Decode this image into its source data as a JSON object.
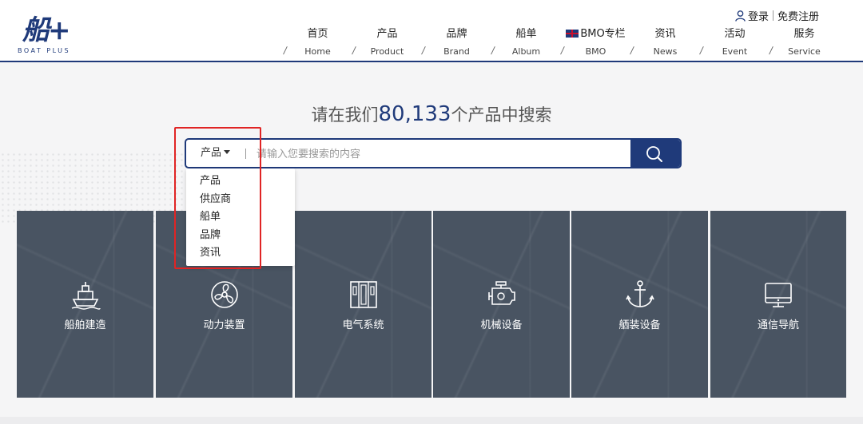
{
  "logo": {
    "cn": "船+",
    "en": "BOAT PLUS"
  },
  "auth": {
    "login": "登录",
    "register": "免费注册"
  },
  "nav": [
    {
      "cn": "首页",
      "en": "Home"
    },
    {
      "cn": "产品",
      "en": "Product"
    },
    {
      "cn": "品牌",
      "en": "Brand"
    },
    {
      "cn": "船单",
      "en": "Album"
    },
    {
      "cn": "BMO专栏",
      "en": "BMO"
    },
    {
      "cn": "资讯",
      "en": "News"
    },
    {
      "cn": "活动",
      "en": "Event"
    },
    {
      "cn": "服务",
      "en": "Service"
    }
  ],
  "search": {
    "headline_prefix": "请在我们",
    "count": "80,133",
    "headline_suffix": "个产品中搜索",
    "type_selected": "产品",
    "placeholder": "请输入您要搜索的内容",
    "dropdown": [
      "产品",
      "供应商",
      "船单",
      "品牌",
      "资讯"
    ]
  },
  "categories": [
    {
      "label": "船舶建造",
      "icon": "ship-icon"
    },
    {
      "label": "动力装置",
      "icon": "propeller-icon"
    },
    {
      "label": "电气系统",
      "icon": "electrical-panel-icon"
    },
    {
      "label": "机械设备",
      "icon": "engine-icon"
    },
    {
      "label": "舾装设备",
      "icon": "anchor-icon"
    },
    {
      "label": "通信导航",
      "icon": "monitor-icon"
    }
  ],
  "colors": {
    "brand": "#1f3a7a",
    "highlight": "#e02424",
    "tile_bg": "#495462"
  }
}
